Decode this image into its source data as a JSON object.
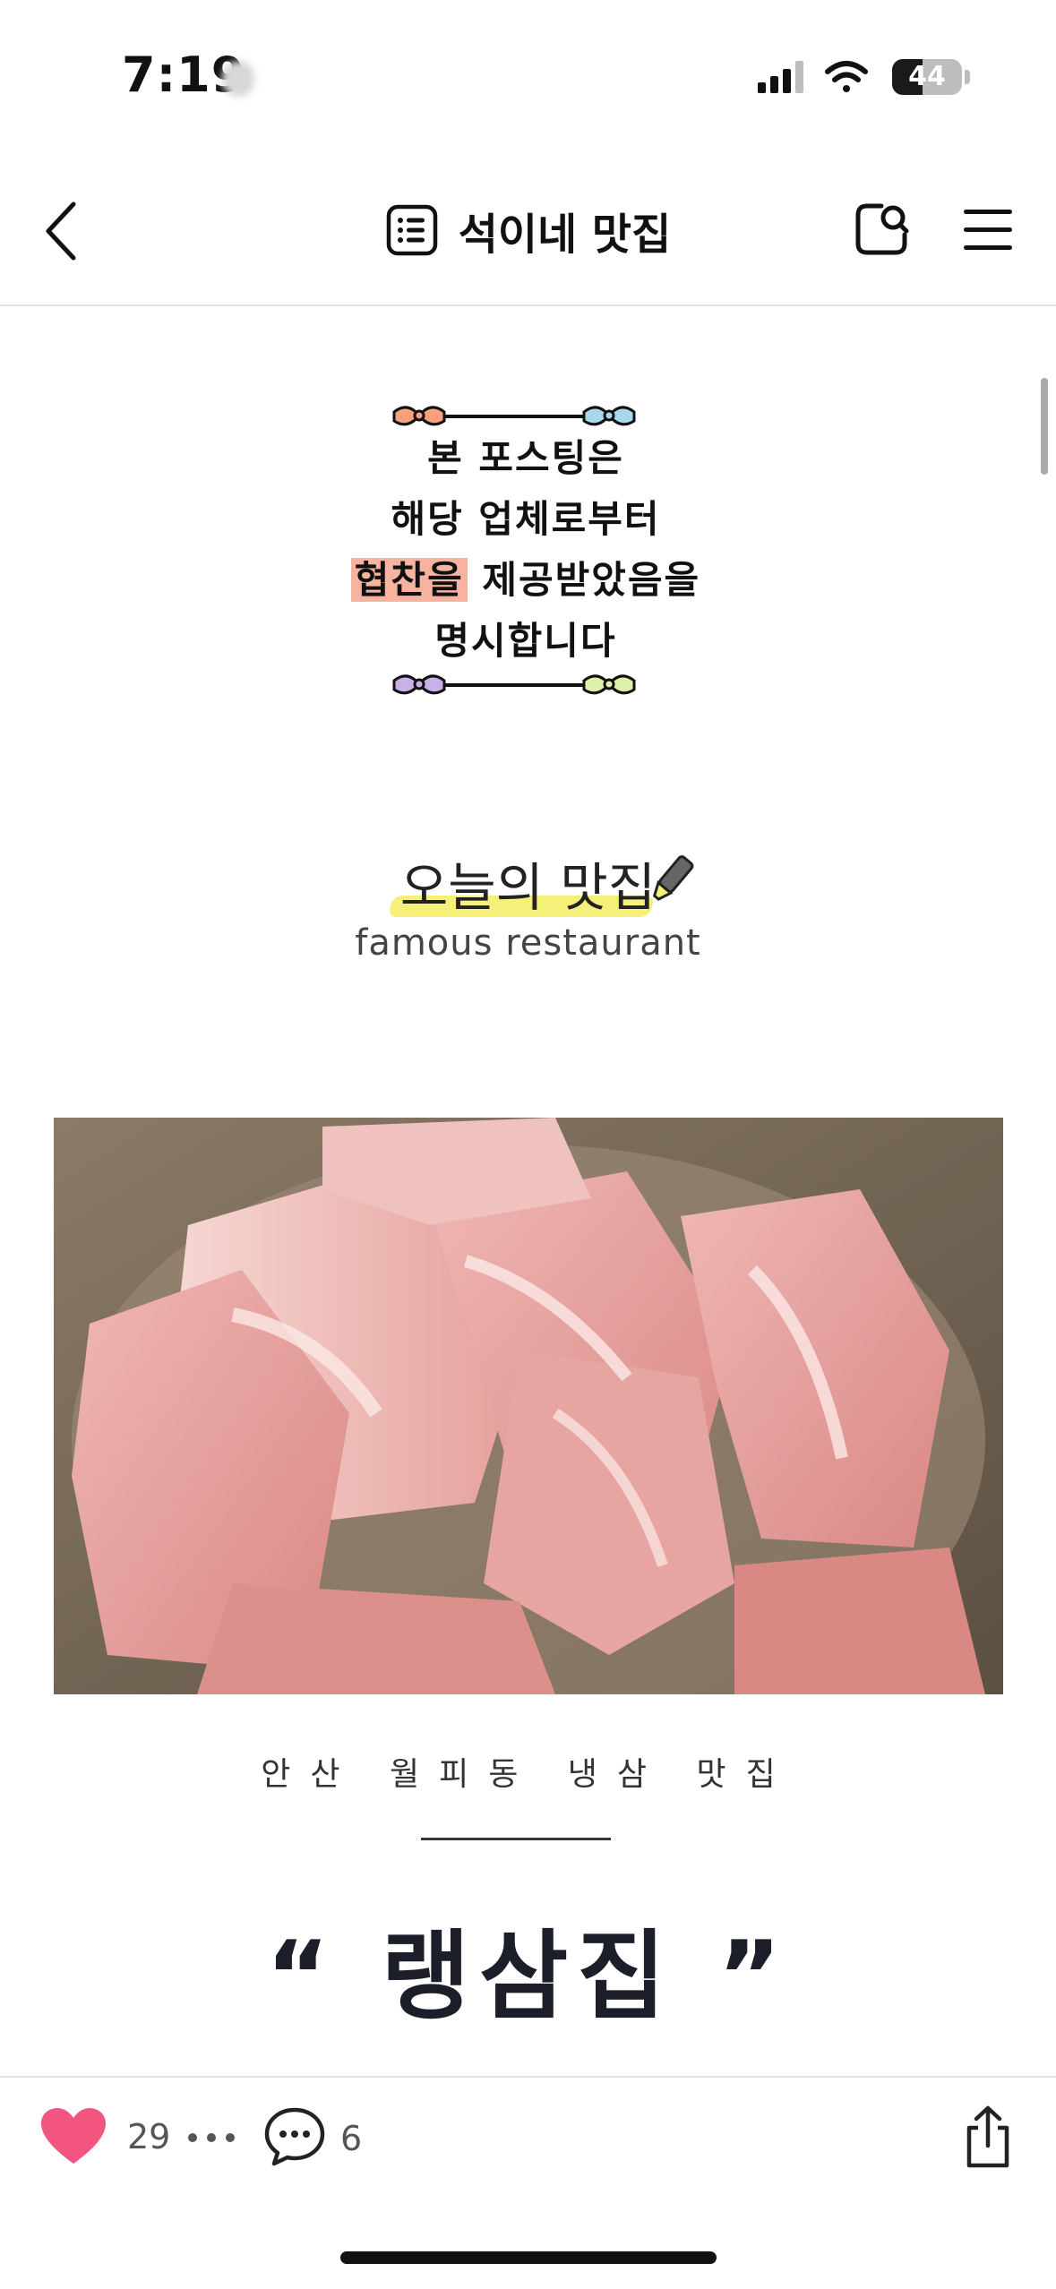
{
  "status_bar": {
    "time": "7:19",
    "battery": "44",
    "battery_level_percent": 44
  },
  "nav": {
    "title": "석이네 맛집"
  },
  "disclosure": {
    "lines": [
      "본 포스팅은",
      "해당 업체로부터",
      "제공받았음을",
      "명시합니다"
    ],
    "highlight": "협찬을"
  },
  "today": {
    "title": "오늘의 맛집",
    "subtitle": "famous restaurant"
  },
  "post": {
    "location": "안산 월피동 냉삼 맛집",
    "name": "“ 랭삼집 ”"
  },
  "bottom_bar": {
    "likes": "29",
    "comments": "6"
  },
  "colors": {
    "like_heart": "#f2557f",
    "highlight": "#f6b4a0",
    "underline": "#f5f07a"
  }
}
